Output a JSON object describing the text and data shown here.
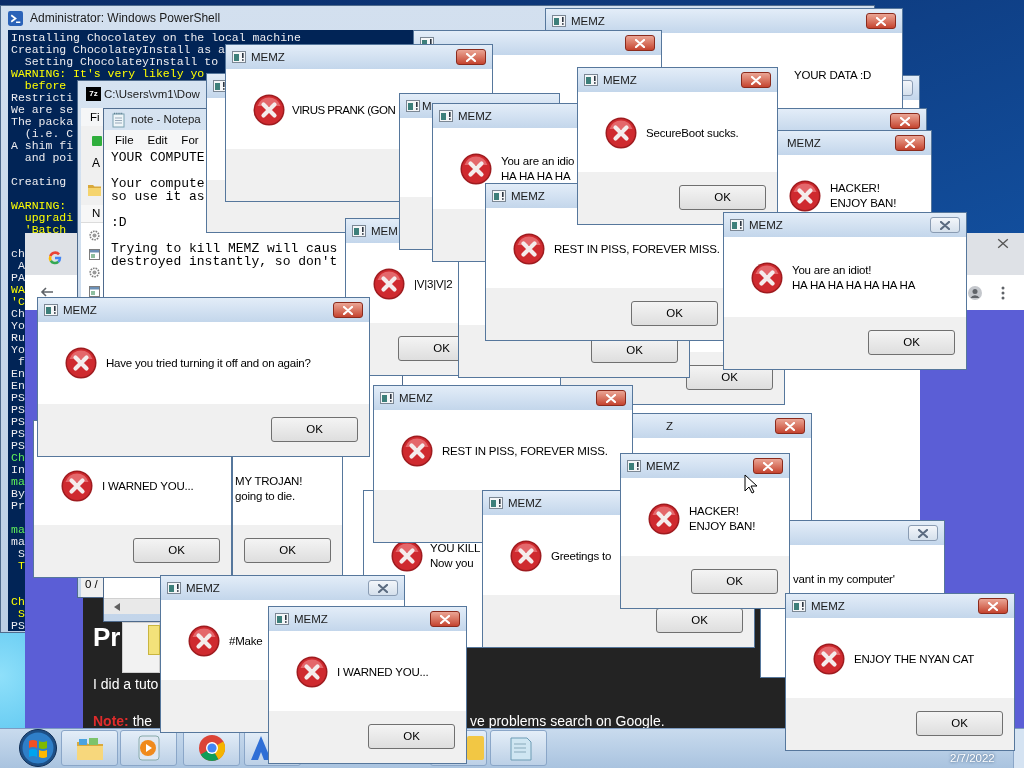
{
  "powershell": {
    "title": "Administrator: Windows PowerShell",
    "lines": [
      {
        "text": "Installing Chocolatey on the local machine",
        "kind": "output"
      },
      {
        "text": "Creating ChocolateyInstall as a",
        "kind": "output"
      },
      {
        "text": "  Setting ChocolateyInstall to",
        "kind": "output"
      },
      {
        "text": "WARNING: It's very likely yo",
        "kind": "warning"
      },
      {
        "text": "  before",
        "kind": "warning"
      },
      {
        "text": "Restricti",
        "kind": "output"
      },
      {
        "text": "We are se",
        "kind": "output"
      },
      {
        "text": "The packa",
        "kind": "output"
      },
      {
        "text": "  (i.e. C",
        "kind": "output"
      },
      {
        "text": "A shim fi",
        "kind": "output"
      },
      {
        "text": "  and poi",
        "kind": "output"
      },
      {
        "text": "Creating",
        "kind": "output"
      },
      {
        "text": "WARNING:",
        "kind": "warning"
      },
      {
        "text": "  upgradi",
        "kind": "warning"
      },
      {
        "text": "  'Batch",
        "kind": "warning"
      },
      {
        "text": "ch",
        "kind": "output"
      },
      {
        "text": " A",
        "kind": "output"
      },
      {
        "text": "PA",
        "kind": "output"
      },
      {
        "text": "WA",
        "kind": "warning"
      },
      {
        "text": "'C",
        "kind": "warning"
      },
      {
        "text": "Ch",
        "kind": "output"
      },
      {
        "text": "Yo",
        "kind": "output"
      },
      {
        "text": "Ru",
        "kind": "output"
      },
      {
        "text": "Yo",
        "kind": "output"
      },
      {
        "text": " f",
        "kind": "output"
      },
      {
        "text": "En",
        "kind": "output"
      },
      {
        "text": "En",
        "kind": "output"
      },
      {
        "text": "PS",
        "kind": "output"
      },
      {
        "text": "PS",
        "kind": "output"
      },
      {
        "text": "PS",
        "kind": "output"
      },
      {
        "text": "PS",
        "kind": "output"
      },
      {
        "text": "PS",
        "kind": "output"
      },
      {
        "text": "Ch",
        "kind": "success"
      },
      {
        "text": "In",
        "kind": "output"
      },
      {
        "text": "ma",
        "kind": "success"
      },
      {
        "text": "By",
        "kind": "output"
      },
      {
        "text": "Pr",
        "kind": "output"
      },
      {
        "text": "ma",
        "kind": "success"
      },
      {
        "text": "ma",
        "kind": "output"
      },
      {
        "text": " S",
        "kind": "output"
      },
      {
        "text": " T",
        "kind": "warning"
      },
      {
        "text": "Ch",
        "kind": "warning"
      },
      {
        "text": " S",
        "kind": "warning"
      },
      {
        "text": "PS",
        "kind": "output"
      }
    ]
  },
  "browser": {
    "page": {
      "heading": "Pr",
      "paragraph": "I did a tuto",
      "note": {
        "label": "Note:",
        "text": "the"
      },
      "continuation": "ve problems search on Google."
    }
  },
  "archive_window": {
    "logo": "7z",
    "title": "C:\\Users\\vm1\\Dow",
    "menu": [
      "Fi"
    ],
    "address_label": "A",
    "column_1": "N",
    "status": "0 /"
  },
  "notepad": {
    "title": "note - Notepa",
    "menu": [
      "File",
      "Edit",
      "For"
    ],
    "lines": [
      "YOUR COMPUTE",
      "Your compute",
      "so use it as",
      ":D",
      "Trying to kill MEMZ will caus",
      "destroyed instantly, so don't"
    ]
  },
  "dialogs": [
    {
      "title": "MEMZ",
      "focused": true,
      "message": [
        "YOUR DATA :D"
      ]
    },
    {
      "focused": true
    },
    {
      "title": "MEMZ",
      "focused": true,
      "message": [
        "VIRUS PRANK (GON"
      ]
    },
    {
      "title": "MEMZ",
      "focused": true,
      "message": [
        "SecureBoot sucks."
      ],
      "button": "OK"
    },
    {
      "focused": false
    },
    {
      "title": "M"
    },
    {
      "title": "MEMZ",
      "message": [
        "You are an idio",
        "HA HA HA HA"
      ]
    },
    {
      "focused": true
    },
    {
      "title": "MEMZ",
      "focused": true,
      "message": [
        "HACKER!",
        "ENJOY BAN!"
      ]
    },
    {
      "title": "MEMZ",
      "message": [
        "REST IN PISS, FOREVER MISS."
      ],
      "button": "OK"
    },
    {
      "title": "MEMZ",
      "focused": false,
      "message": [
        "You are an idiot!",
        "HA HA HA HA HA HA HA"
      ],
      "button": "OK"
    },
    {
      "title": "MEM",
      "message": [
        "|V|3|V|2"
      ],
      "button": "OK"
    },
    {
      "button": "OK"
    },
    {
      "button": "OK"
    },
    {
      "title": "MEMZ",
      "focused": true,
      "message": [
        "Have you tried turning it off and on again?"
      ],
      "button": "OK"
    },
    {
      "title": "MEMZ",
      "focused": true,
      "message": [
        "REST IN PISS, FOREVER MISS."
      ]
    },
    {
      "title": "Z",
      "focused": true
    },
    {
      "message": [
        "I WARNED YOU..."
      ],
      "button": "OK"
    },
    {
      "message": [
        "MY TROJAN!",
        "going to die."
      ],
      "button": "OK"
    },
    {
      "title": "MEMZ",
      "focused": true,
      "message": [
        "HACKER!",
        "ENJOY BAN!"
      ],
      "button": "OK"
    },
    {
      "message": [
        "YOU KILL",
        "Now you"
      ]
    },
    {
      "title": "MEMZ",
      "message": [
        "Greetings to"
      ],
      "button": "OK"
    },
    {
      "focused": false,
      "message": [
        "vant in my computer'"
      ]
    },
    {
      "title": "MEMZ",
      "focused": false,
      "message": [
        "#Make"
      ]
    },
    {
      "title": "MEMZ",
      "focused": true,
      "message": [
        "ENJOY THE NYAN CAT"
      ],
      "button": "OK"
    },
    {
      "title": "MEMZ",
      "focused": true,
      "message": [
        "I WARNED YOU..."
      ],
      "button": "OK"
    }
  ],
  "taskbar": {
    "clock": "2/7/2022"
  }
}
